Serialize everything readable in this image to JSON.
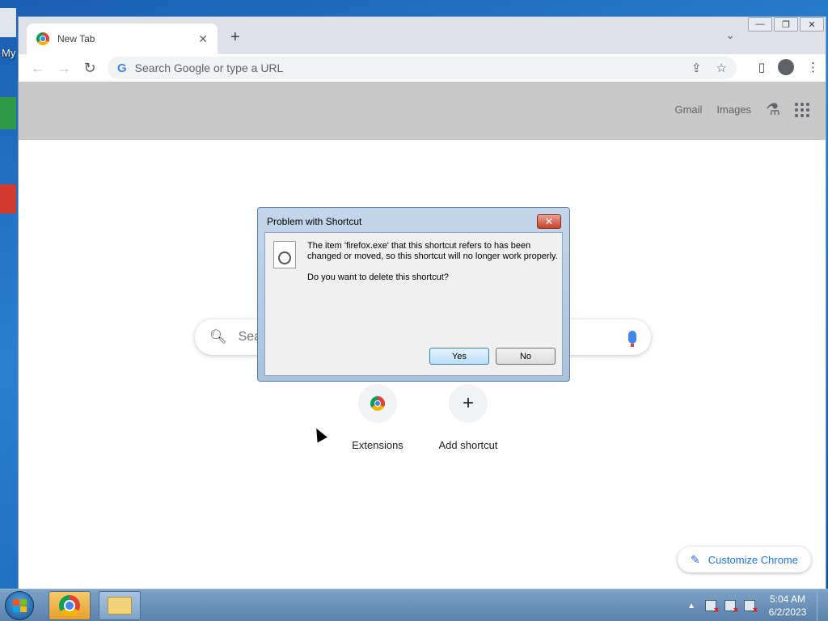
{
  "desktop": {
    "icon_label_partial": "My"
  },
  "window": {
    "minimize": "—",
    "maximize": "❐",
    "close": "✕"
  },
  "tab": {
    "title": "New Tab",
    "close": "✕",
    "new_tab": "+",
    "tab_menu": "⌄"
  },
  "toolbar": {
    "back": "←",
    "forward": "→",
    "reload": "↻",
    "omnibox_logo": "G",
    "omnibox_placeholder": "Search Google or type a URL",
    "share": "⇪",
    "star": "☆",
    "sidepanel": "▯",
    "menu": "⋮"
  },
  "ntp": {
    "gmail": "Gmail",
    "images": "Images",
    "labs": "⚗",
    "search_placeholder": "Sea",
    "shortcuts": [
      {
        "label": "Extensions",
        "icon": "chrome-logo"
      },
      {
        "label": "Add shortcut",
        "icon": "+"
      }
    ],
    "customize": "Customize Chrome",
    "customize_icon": "✎"
  },
  "dialog": {
    "title": "Problem with Shortcut",
    "close": "✕",
    "message": "The item 'firefox.exe' that this shortcut refers to has been changed or moved, so this shortcut will no longer work properly.",
    "question": "Do you want to delete this shortcut?",
    "yes": "Yes",
    "no": "No"
  },
  "taskbar": {
    "tray_up": "▲",
    "time": "5:04 AM",
    "date": "6/2/2023"
  },
  "colors": {
    "accent": "#1a73e8",
    "topbar_overlay": "#c8c8c8"
  }
}
